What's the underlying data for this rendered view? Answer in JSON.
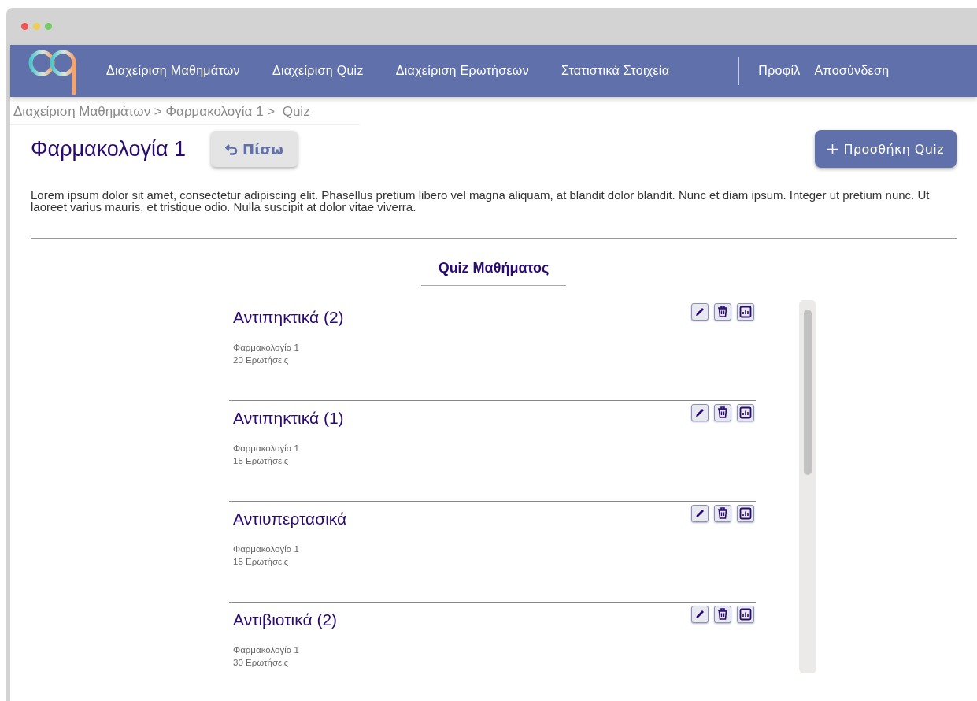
{
  "nav": {
    "items": [
      {
        "label": "Διαχείριση Μαθημάτων"
      },
      {
        "label": "Διαχείριση Quiz"
      },
      {
        "label": "Διαχείριση Ερωτήσεων"
      },
      {
        "label": "Στατιστικά Στοιχεία"
      }
    ],
    "account": [
      {
        "label": "Προφίλ"
      },
      {
        "label": "Αποσύνδεση"
      }
    ]
  },
  "breadcrumb": "Διαχείριση Μαθημάτων > Φαρμακολογία 1 >  Quiz",
  "course": {
    "title": "Φαρμακολογία 1",
    "back_button": "Πίσω",
    "add_button": "Προσθήκη Quiz",
    "description": "Lorem ipsum dolor sit amet, consectetur adipiscing elit. Phasellus pretium libero vel magna aliquam, at blandit dolor blandit. Nunc et diam ipsum. Integer ut pretium nunc. Ut laoreet varius mauris, et tristique odio. Nulla suscipit at dolor vitae viverra."
  },
  "quiz_list": {
    "heading": "Quiz Μαθήματος",
    "items": [
      {
        "title": "Αντιπηκτικά (2)",
        "course": "Φαρμακολογία 1",
        "questions": "20 Ερωτήσεις"
      },
      {
        "title": "Αντιπηκτικά (1)",
        "course": "Φαρμακολογία 1",
        "questions": "15 Ερωτήσεις"
      },
      {
        "title": "Αντιυπερτασικά",
        "course": "Φαρμακολογία 1",
        "questions": "15 Ερωτήσεις"
      },
      {
        "title": "Αντιβιοτικά (2)",
        "course": "Φαρμακολογία 1",
        "questions": "30 Ερωτήσεις"
      }
    ]
  }
}
